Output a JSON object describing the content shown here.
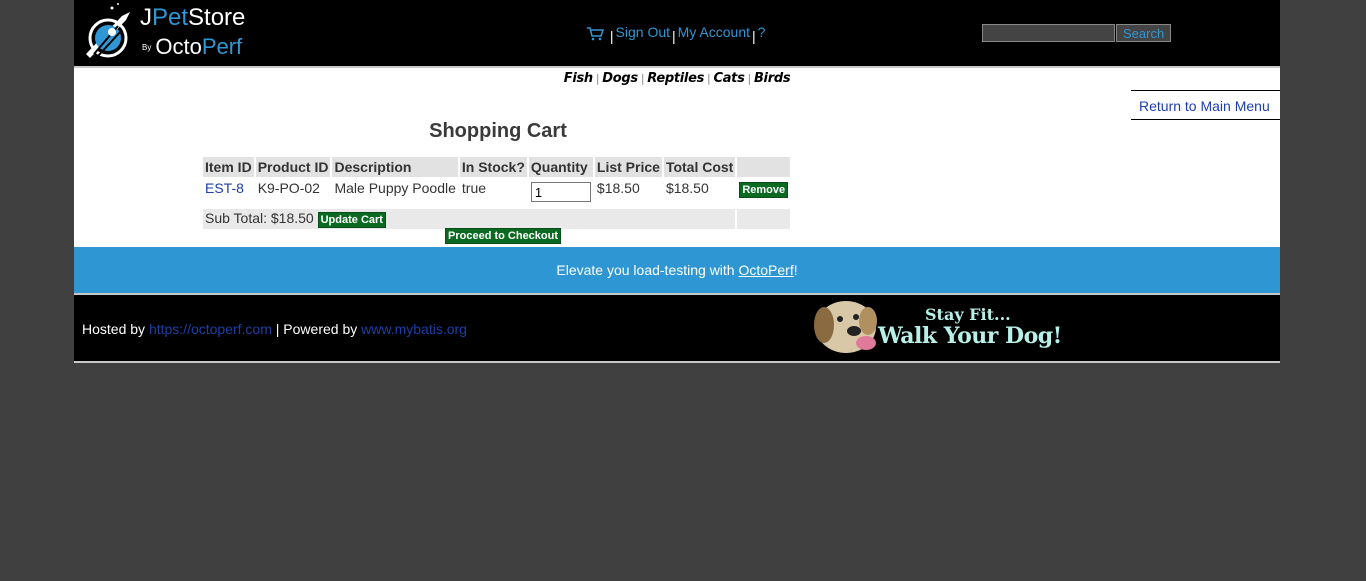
{
  "header": {
    "logo": {
      "line1_prefix": "J",
      "line1_pet": "Pet",
      "line1_store": "Store",
      "line2_by": "By",
      "line2_octo": "Octo",
      "line2_perf": "Perf"
    },
    "menu": {
      "sign_out": "Sign Out",
      "my_account": "My Account",
      "help": "?",
      "separator": "|"
    },
    "search": {
      "value": "",
      "button_label": "Search"
    }
  },
  "quicklinks": [
    "Fish",
    "Dogs",
    "Reptiles",
    "Cats",
    "Birds"
  ],
  "return_link": "Return to Main Menu",
  "cart": {
    "title": "Shopping Cart",
    "columns": [
      "Item ID",
      "Product ID",
      "Description",
      "In Stock?",
      "Quantity",
      "List Price",
      "Total Cost"
    ],
    "rows": [
      {
        "item_id": "EST-8",
        "product_id": "K9-PO-02",
        "description": "Male Puppy Poodle",
        "in_stock": "true",
        "quantity": "1",
        "list_price": "$18.50",
        "total_cost": "$18.50",
        "remove_label": "Remove"
      }
    ],
    "subtotal_label": "Sub Total: $18.50",
    "update_label": "Update Cart",
    "checkout_label": "Proceed to Checkout"
  },
  "banner": {
    "text": "Elevate you load-testing with ",
    "link": "OctoPerf",
    "suffix": "!"
  },
  "footer": {
    "hosted_by": "Hosted by ",
    "hosted_link": "https://octoperf.com",
    "powered_by": " | Powered by ",
    "powered_link": "www.mybatis.org",
    "slogan1": "Stay Fit...",
    "slogan2": "Walk Your Dog!"
  },
  "colors": {
    "accent_blue": "#2f97d5",
    "banner_blue": "#2e96d2",
    "button_green": "#0b6a21",
    "link_blue": "#1c3fa8"
  },
  "icons": [
    "rocket-logo-icon",
    "cart-icon"
  ]
}
